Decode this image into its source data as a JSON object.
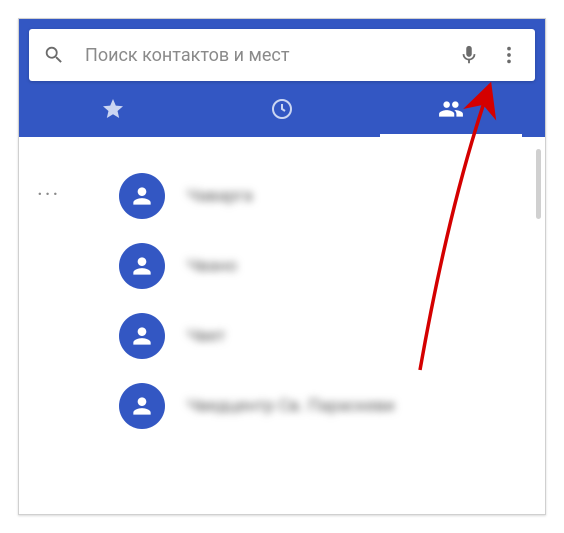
{
  "search": {
    "placeholder": "Поиск контактов и мест"
  },
  "contacts": [
    {
      "name": "Чаварга"
    },
    {
      "name": "Чвано"
    },
    {
      "name": "Чвет"
    },
    {
      "name": "Чведцентр Св. Параскеви"
    }
  ],
  "colors": {
    "primary": "#3357c3"
  }
}
